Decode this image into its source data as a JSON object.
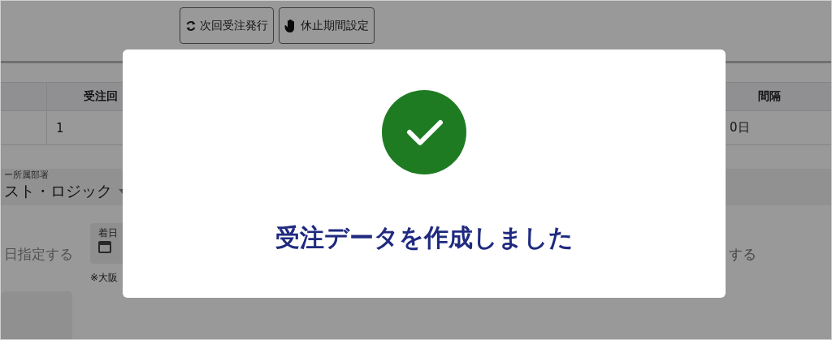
{
  "toolbar": {
    "buttons": [
      {
        "label": "次回受注発行"
      },
      {
        "label": "休止期間設定"
      }
    ]
  },
  "table": {
    "columns": [
      "受注回",
      "間隔"
    ],
    "rows": [
      [
        "1",
        "0日"
      ]
    ]
  },
  "form": {
    "department": {
      "label": "ー所属部署",
      "value": "スト・ロジック"
    },
    "delivery_option": "日指定する",
    "date_field": {
      "label": "着日"
    },
    "note": "※大阪",
    "option_right": "する"
  },
  "dialog": {
    "message": "受注データを作成しました"
  }
}
